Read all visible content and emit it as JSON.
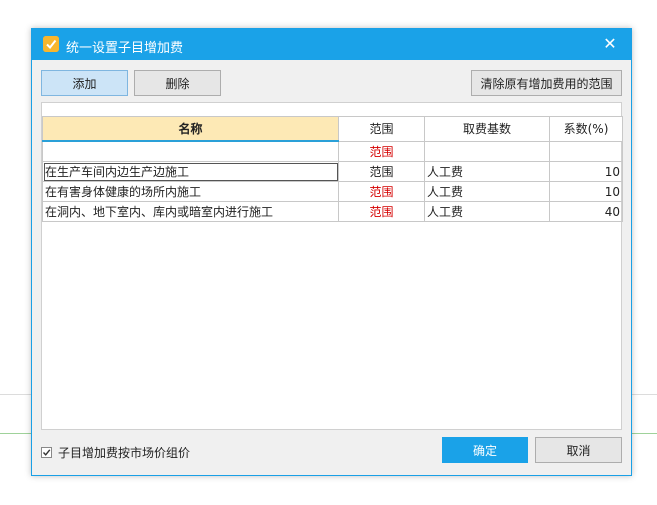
{
  "window": {
    "title": "统一设置子目增加费",
    "close_glyph": "✕"
  },
  "toolbar": {
    "add_label": "添加",
    "delete_label": "删除",
    "clear_label": "清除原有增加费用的范围"
  },
  "table": {
    "columns": [
      "名称",
      "范围",
      "取费基数",
      "系数(%)"
    ],
    "filter_row": {
      "name": "",
      "scope": "范围",
      "base": "",
      "coef": ""
    },
    "rows": [
      {
        "name": "在生产车间内边生产边施工",
        "scope": "范围",
        "base": "人工费",
        "coef": "10"
      },
      {
        "name": "在有害身体健康的场所内施工",
        "scope": "范围",
        "base": "人工费",
        "coef": "10"
      },
      {
        "name": "在洞内、地下室内、库内或暗室内进行施工",
        "scope": "范围",
        "base": "人工费",
        "coef": "40"
      }
    ]
  },
  "footer": {
    "checkbox_label": "子目增加费按市场价组价",
    "checkbox_checked": true,
    "ok_label": "确定",
    "cancel_label": "取消"
  },
  "colors": {
    "accent": "#1aa2e8",
    "header_highlight": "#fde9b5",
    "scope_red": "#d40000"
  }
}
